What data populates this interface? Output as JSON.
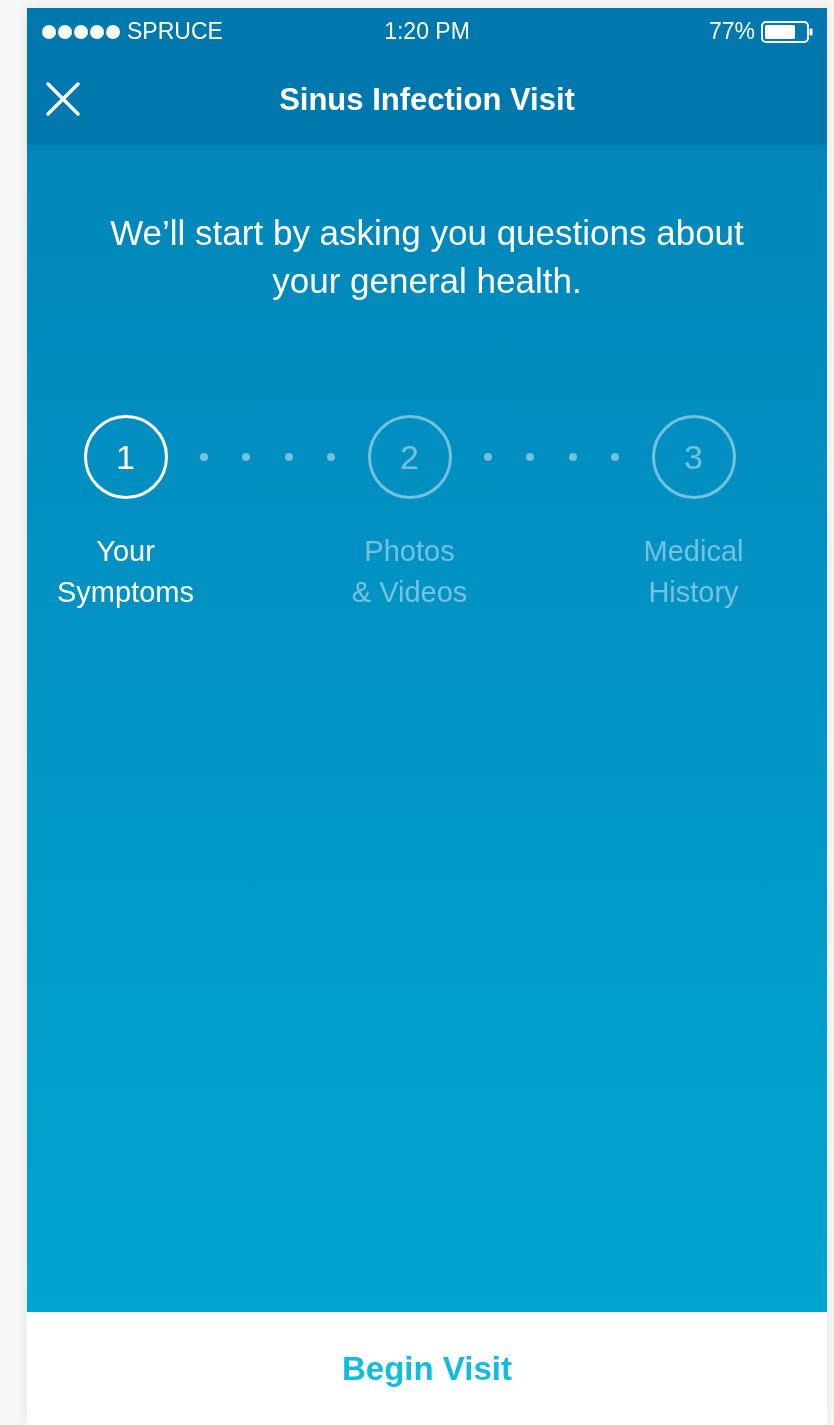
{
  "status_bar": {
    "carrier": "SPRUCE",
    "time": "1:20 PM",
    "battery": "77%"
  },
  "nav_bar": {
    "title": "Sinus Infection Visit"
  },
  "intro": "We’ll start by asking you questions about your general health.",
  "steps": [
    {
      "number": "1",
      "label": "Your\nSymptoms",
      "selected": true
    },
    {
      "number": "2",
      "label": "Photos\n& Videos",
      "selected": false
    },
    {
      "number": "3",
      "label": "Medical\nHistory",
      "selected": false
    }
  ],
  "footer": {
    "button": "Begin Visit"
  }
}
